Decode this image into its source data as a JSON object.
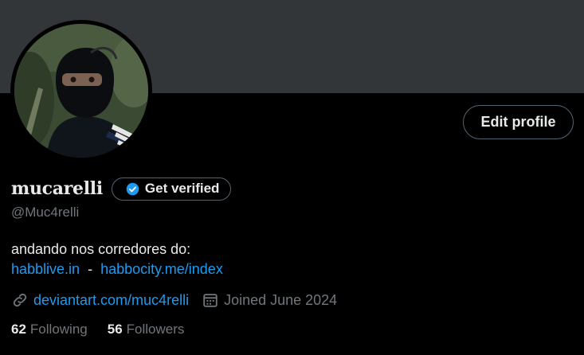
{
  "profile": {
    "display_name": "mucarelli",
    "handle": "@Muc4relli",
    "verify_label": "Get verified",
    "edit_label": "Edit profile",
    "bio_line1": "andando nos corredores do:",
    "bio_link1": "habblive.in",
    "bio_separator": "-",
    "bio_link2": "habbocity.me/index",
    "website": "deviantart.com/muc4relli",
    "joined": "Joined June 2024",
    "following_count": "62",
    "following_label": "Following",
    "followers_count": "56",
    "followers_label": "Followers"
  },
  "icons": {
    "verified": "verified-badge-icon",
    "link": "link-icon",
    "calendar": "calendar-icon"
  },
  "colors": {
    "background": "#000000",
    "banner": "#333639",
    "text_primary": "#e7e9ea",
    "text_secondary": "#71767b",
    "link": "#1d9bf0",
    "border": "#536471"
  }
}
